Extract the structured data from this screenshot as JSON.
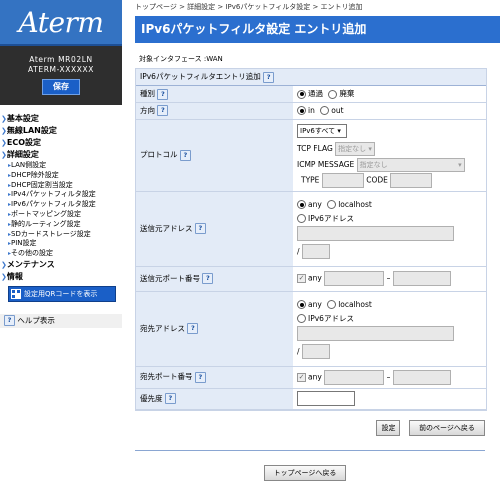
{
  "brand": {
    "logo": "Aterm",
    "model": "Aterm MR02LN",
    "sub": "ATERM-XXXXXX",
    "save_label": "保存"
  },
  "nav": {
    "basic": "基本設定",
    "wlan": "無線LAN設定",
    "eco": "ECO設定",
    "detail": "詳細設定",
    "sub_items": [
      "LAN側設定",
      "DHCP除外設定",
      "DHCP固定割当設定",
      "IPv4パケットフィルタ設定",
      "IPv6パケットフィルタ設定",
      "ポートマッピング設定",
      "静的ルーティング設定",
      "SDカードストレージ設定",
      "PIN設定",
      "その他の設定"
    ],
    "maintenance": "メンテナンス",
    "info": "情報",
    "qr_label": "設定用QRコードを表示",
    "help_label": "ヘルプ表示"
  },
  "breadcrumb": "トップページ > 詳細設定 > IPv6パケットフィルタ設定 > エントリ追加",
  "page_title": "IPv6パケットフィルタ設定 エントリ追加",
  "target_interface": "対象インタフェース :WAN",
  "section_title": "IPv6パケットフィルタエントリ追加",
  "form": {
    "type_label": "種別",
    "type_opt_pass": "通過",
    "type_opt_discard": "廃棄",
    "direction_label": "方向",
    "dir_in": "in",
    "dir_out": "out",
    "protocol_label": "プロトコル",
    "protocol_value": "IPv6すべて",
    "tcp_flag_label": "TCP FLAG",
    "tcp_flag_value": "指定なし",
    "icmp_label": "ICMP MESSAGE",
    "icmp_value": "指定なし",
    "icmp_type_label": "TYPE",
    "icmp_code_label": "CODE",
    "src_addr_label": "送信元アドレス",
    "addr_any": "any",
    "addr_localhost": "localhost",
    "addr_ipv6": "IPv6アドレス",
    "prefix_sep": "/",
    "src_port_label": "送信元ポート番号",
    "port_any": "any",
    "port_sep": "–",
    "dst_addr_label": "宛先アドレス",
    "dst_port_label": "宛先ポート番号",
    "priority_label": "優先度",
    "help_glyph": "?"
  },
  "buttons": {
    "set": "設定",
    "back": "前のページへ戻る",
    "top": "トップページへ戻る"
  },
  "colors": {
    "header_blue": "#2b6fcf",
    "label_bg": "#e3ebf7",
    "dark": "#2e2e2e"
  }
}
